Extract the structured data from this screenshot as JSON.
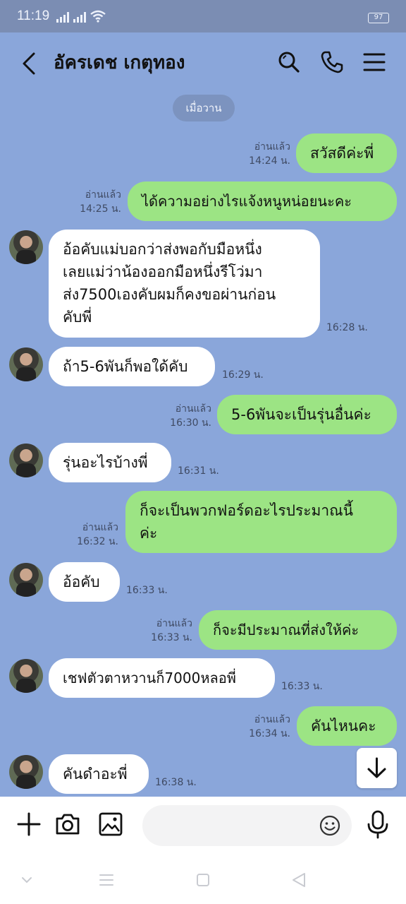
{
  "status_bar": {
    "time": "11:19",
    "battery": "97"
  },
  "header": {
    "title": "อัครเดช เกตุทอง"
  },
  "date_separator": "เมื่อวาน",
  "messages": [
    {
      "side": "me",
      "text": "สวัสดีค่ะพี่",
      "read": "อ่านแล้ว",
      "time": "14:24 น."
    },
    {
      "side": "me",
      "text": "ได้ความอย่างไรแจ้งหนูหน่อยนะคะ",
      "read": "อ่านแล้ว",
      "time": "14:25 น."
    },
    {
      "side": "them",
      "lines": [
        "อ้อคับแม่บอกว่าส่งพอกับมือหนึ่ง",
        "เลยแม่ว่าน้องออกมือหนึ่งรีโว่มา",
        "ส่ง7500เองคับผมก็คงขอผ่านก่อน",
        "คับพี่"
      ],
      "time": "16:28 น."
    },
    {
      "side": "them",
      "text": "ถ้า5-6พันก็พอใด้คับ",
      "time": "16:29 น."
    },
    {
      "side": "me",
      "text": "5-6พันจะเป็นรุ่นอื่นค่ะ",
      "read": "อ่านแล้ว",
      "time": "16:30 น."
    },
    {
      "side": "them",
      "text": "รุ่นอะไรบ้างพี่",
      "time": "16:31 น."
    },
    {
      "side": "me",
      "lines": [
        "ก็จะเป็นพวกฟอร์ดอะไรประมาณนี้",
        "ค่ะ"
      ],
      "read": "อ่านแล้ว",
      "time": "16:32 น."
    },
    {
      "side": "them",
      "text": "อ้อคับ",
      "time": "16:33 น."
    },
    {
      "side": "me",
      "text": "ก็จะมีประมาณที่ส่งให้ค่ะ",
      "read": "อ่านแล้ว",
      "time": "16:33 น."
    },
    {
      "side": "them",
      "text": "เชฟตัวตาหวานก็7000หลอพี่",
      "time": "16:33 น."
    },
    {
      "side": "me",
      "text": "คันไหนคะ",
      "read": "อ่านแล้ว",
      "time": "16:34 น."
    },
    {
      "side": "them",
      "text": "คันดำอะพี่",
      "time": "16:38 น."
    }
  ],
  "input": {
    "placeholder": ""
  },
  "colors": {
    "background": "#8aa6da",
    "my_bubble": "#9ce484",
    "their_bubble": "#ffffff"
  }
}
